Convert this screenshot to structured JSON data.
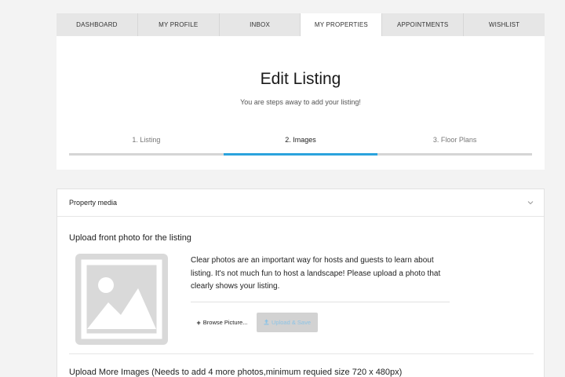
{
  "nav": {
    "tabs": [
      {
        "label": "DASHBOARD"
      },
      {
        "label": "MY PROFILE"
      },
      {
        "label": "INBOX"
      },
      {
        "label": "MY PROPERTIES",
        "active": true
      },
      {
        "label": "APPOINTMENTS"
      },
      {
        "label": "WISHLIST"
      }
    ]
  },
  "header": {
    "title": "Edit Listing",
    "subtitle": "You are steps away to add your listing!"
  },
  "steps": [
    {
      "label": "1. Listing"
    },
    {
      "label": "2. Images",
      "active": true
    },
    {
      "label": "3. Floor Plans"
    }
  ],
  "media": {
    "section_title": "Property media",
    "front_photo_label": "Upload front photo for the listing",
    "description": "Clear photos are an important way for hosts and guests to learn about listing. It's not much fun to host a landscape! Please upload a photo that clearly shows your listing.",
    "browse_label": "Browse Picture...",
    "upload_label": "Upload & Save",
    "more_images_label": "Upload More Images  (Needs to add 4 more photos,minimum requied size 720 x 480px)"
  },
  "colors": {
    "accent": "#2aa3dd",
    "upload_text": "#8cc3e6"
  }
}
